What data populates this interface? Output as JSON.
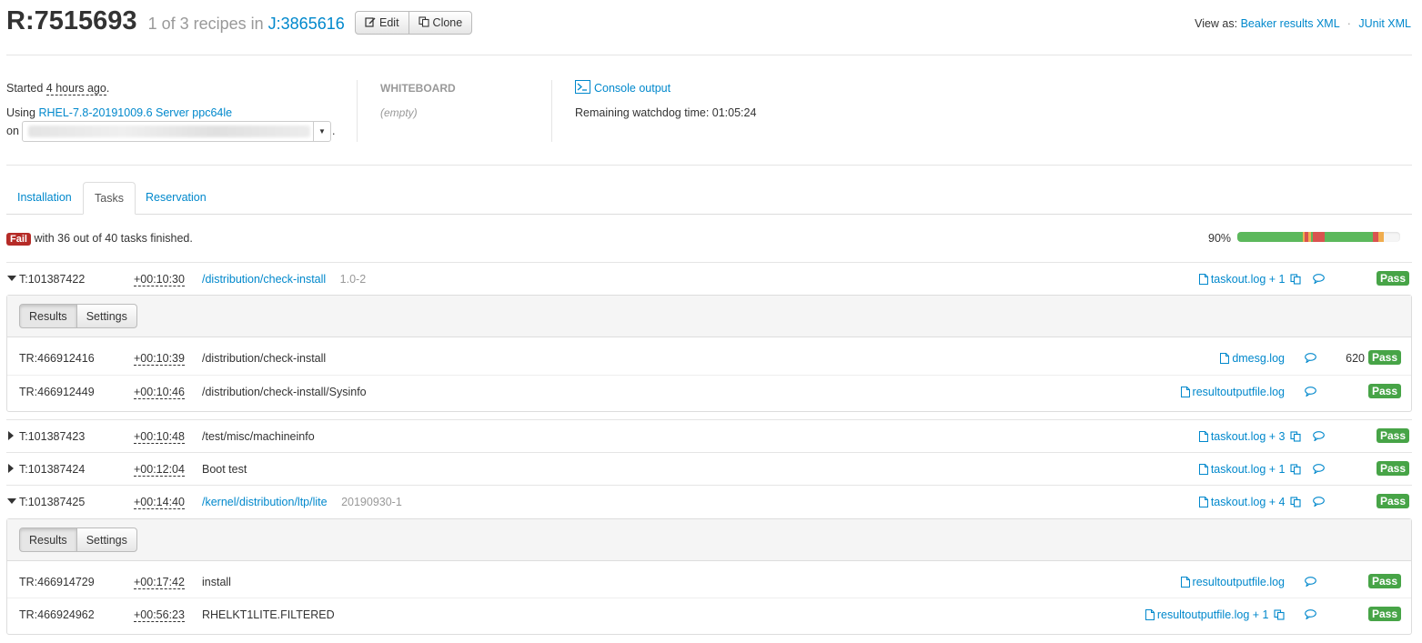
{
  "header": {
    "recipe_id": "R:7515693",
    "recipe_position": "1 of 3 recipes in",
    "job_link": "J:3865616",
    "edit_label": "Edit",
    "clone_label": "Clone",
    "view_as_label": "View as:",
    "beaker_xml": "Beaker results XML",
    "junit_xml": "JUnit XML",
    "separator": "·"
  },
  "info": {
    "started_prefix": "Started",
    "started_when": "4 hours ago",
    "started_suffix": ".",
    "using_prefix": "Using",
    "distro": "RHEL-7.8-20191009.6 Server ppc64le",
    "on_prefix": "on",
    "on_suffix": ".",
    "whiteboard_heading": "WHITEBOARD",
    "whiteboard_value": "(empty)",
    "console_output": "Console output",
    "watchdog": "Remaining watchdog time: 01:05:24"
  },
  "tabs": [
    "Installation",
    "Tasks",
    "Reservation"
  ],
  "summary": {
    "status": "Fail",
    "text": "with 36 out of 40 tasks finished.",
    "percent": "90%",
    "progress_segments": [
      {
        "fraction": 0.4,
        "color": "#5cb85c"
      },
      {
        "fraction": 0.015,
        "color": "#f0ad4e"
      },
      {
        "fraction": 0.02,
        "color": "#d9534f"
      },
      {
        "fraction": 0.015,
        "color": "#f0ad4e"
      },
      {
        "fraction": 0.015,
        "color": "#5cb85c"
      },
      {
        "fraction": 0.07,
        "color": "#d9534f"
      },
      {
        "fraction": 0.3,
        "color": "#5cb85c"
      },
      {
        "fraction": 0.03,
        "color": "#d9534f"
      },
      {
        "fraction": 0.035,
        "color": "#f0ad4e"
      }
    ]
  },
  "colors": {
    "link": "#0088cc",
    "pass": "#47a447",
    "fail": "#b52b27"
  },
  "panel_buttons": {
    "results": "Results",
    "settings": "Settings"
  },
  "tasks": [
    {
      "id": "T:101387422",
      "duration": "+00:10:30",
      "name": "/distribution/check-install",
      "version": "1.0-2",
      "log": "taskout.log",
      "extra": "+ 1",
      "status": "Pass"
    },
    {
      "id": "T:101387423",
      "duration": "+00:10:48",
      "name": "/test/misc/machineinfo",
      "version": "",
      "log": "taskout.log",
      "extra": "+ 3",
      "status": "Pass"
    },
    {
      "id": "T:101387424",
      "duration": "+00:12:04",
      "name": "Boot test",
      "version": "",
      "log": "taskout.log",
      "extra": "+ 1",
      "status": "Pass"
    },
    {
      "id": "T:101387425",
      "duration": "+00:14:40",
      "name": "/kernel/distribution/ltp/lite",
      "version": "20190930-1",
      "log": "taskout.log",
      "extra": "+ 4",
      "status": "Pass"
    }
  ],
  "results_1": [
    {
      "id": "TR:466912416",
      "duration": "+00:10:39",
      "name": "/distribution/check-install",
      "log": "dmesg.log",
      "extra": "",
      "score": "620",
      "status": "Pass"
    },
    {
      "id": "TR:466912449",
      "duration": "+00:10:46",
      "name": "/distribution/check-install/Sysinfo",
      "log": "resultoutputfile.log",
      "extra": "",
      "score": "",
      "status": "Pass"
    }
  ],
  "results_4": [
    {
      "id": "TR:466914729",
      "duration": "+00:17:42",
      "name": "install",
      "log": "resultoutputfile.log",
      "extra": "",
      "score": "",
      "status": "Pass"
    },
    {
      "id": "TR:466924962",
      "duration": "+00:56:23",
      "name": "RHELKT1LITE.FILTERED",
      "log": "resultoutputfile.log",
      "extra": "+ 1",
      "score": "",
      "status": "Pass"
    }
  ]
}
